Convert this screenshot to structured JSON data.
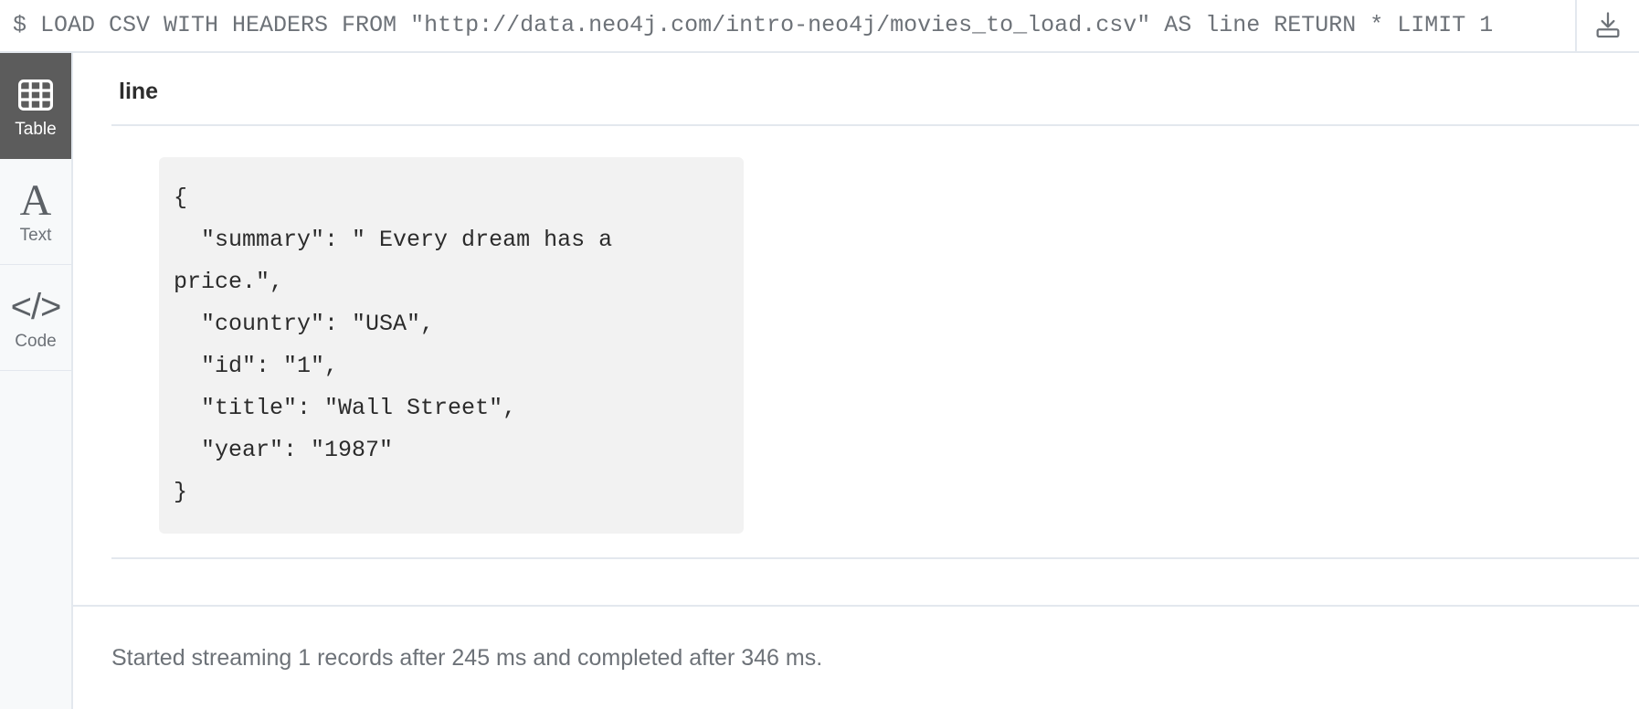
{
  "query_bar": {
    "prompt": "$",
    "query": "LOAD CSV WITH HEADERS FROM \"http://data.neo4j.com/intro-neo4j/movies_to_load.csv\" AS line RETURN * LIMIT 1",
    "full_line": "$ LOAD CSV WITH HEADERS FROM \"http://data.neo4j.com/intro-neo4j/movies_to_load.csv\" AS line RETURN * LIMIT 1",
    "download_icon": "download-icon",
    "download_title": "Download"
  },
  "sidebar": {
    "items": [
      {
        "label": "Table",
        "icon": "table-icon",
        "active": true
      },
      {
        "label": "Text",
        "icon": "text-a-icon",
        "active": false
      },
      {
        "label": "Code",
        "icon": "code-angle-brackets-icon",
        "active": false
      }
    ]
  },
  "result": {
    "column_key": "line",
    "record_json": "{\n  \"summary\": \" Every dream has a price.\",\n  \"country\": \"USA\",\n  \"id\": \"1\",\n  \"title\": \"Wall Street\",\n  \"year\": \"1987\"\n}",
    "record_fields": {
      "summary": " Every dream has a price.",
      "country": "USA",
      "id": "1",
      "title": "Wall Street",
      "year": "1987"
    }
  },
  "status": {
    "message": "Started streaming 1 records after 245 ms and completed after 346 ms.",
    "records": 1,
    "streaming_ms": 245,
    "completed_ms": 346
  },
  "colors": {
    "accent_active": "#5c5c5c",
    "divider": "#e3e8ee",
    "sidebar_bg": "#f7f9fa",
    "code_bg": "#f2f2f2",
    "muted_text": "#6d7278"
  }
}
